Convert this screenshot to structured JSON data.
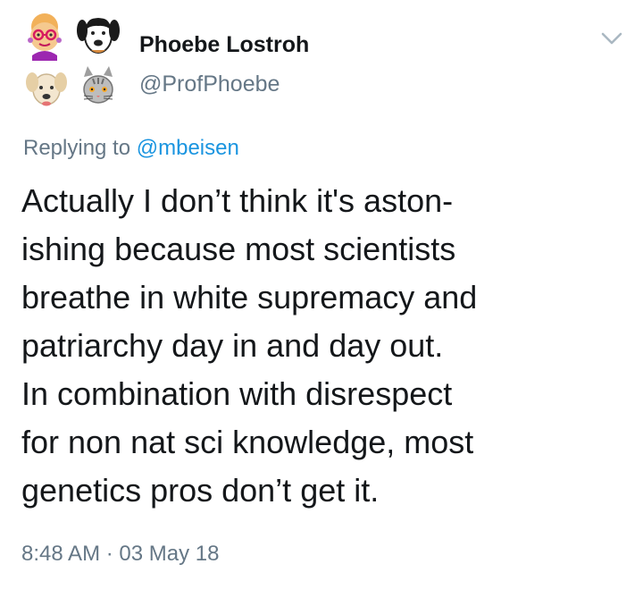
{
  "author": {
    "display_name": "Phoebe Lostroh",
    "handle": "@ProfPhoebe",
    "avatar_icon": "avatar-collage-icon"
  },
  "menu": {
    "icon": "chevron-down-icon"
  },
  "reply": {
    "prefix": "Replying to ",
    "mention": "@mbeisen"
  },
  "tweet": {
    "lines": [
      "Actually I don’t think it's aston-",
      "ishing because most scientists",
      "breathe in white supremacy and",
      "patriarchy day in and day out.",
      "In combination with disrespect",
      "for non nat sci knowledge, most",
      "genetics pros don’t get it."
    ]
  },
  "meta": {
    "time": "8:48 AM",
    "separator": " · ",
    "date": "03 May 18"
  },
  "colors": {
    "text_primary": "#14171a",
    "text_secondary": "#657786",
    "link": "#1b95e0"
  }
}
